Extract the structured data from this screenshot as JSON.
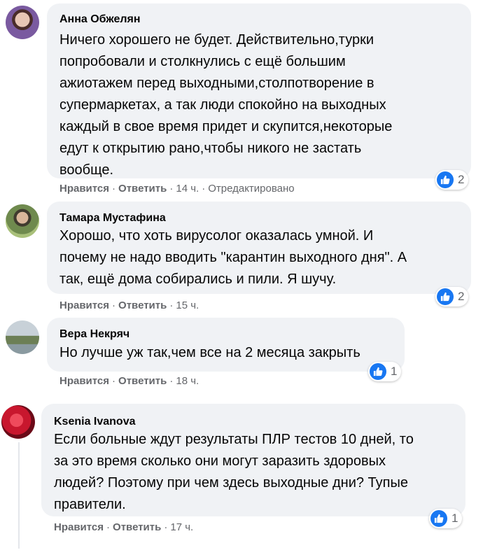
{
  "ui": {
    "like_label": "Нравится",
    "reply_label": "Ответить",
    "separator": "·"
  },
  "comments": [
    {
      "author": "Анна Обжелян",
      "lines": [
        "Ничего хорошего не будет. Действительно,турки",
        "попробовали и столкнулись с ещё большим",
        "ажиотажем перед выходными,столпотворение в",
        "супермаркетах, а так люди спокойно на выходных",
        "каждый в свое время придет и скупится,некоторые",
        "едут к открытию рано,чтобы никого не застать",
        "вообще."
      ],
      "time": "14 ч.",
      "edited": "Отредактировано",
      "reactions": "2",
      "reaction_icon": "like-icon",
      "avatar_colors": [
        "#6b4a8a",
        "#caa2a0"
      ]
    },
    {
      "author": "Тамара Мустафина",
      "lines": [
        "Хорошо, что хоть вирусолог оказалась умной. И",
        "почему не надо вводить \"карантин выходного дня\". А",
        "так, ещё дома собирались и пили. Я шучу."
      ],
      "time": "15 ч.",
      "reactions": "2",
      "reaction_icon": "like-icon",
      "avatar_colors": [
        "#5b7a3e",
        "#c9b7a6"
      ]
    },
    {
      "author": "Вера Некряч",
      "lines": [
        "Но лучше уж так,чем все на 2 месяца закрыть"
      ],
      "time": "18 ч.",
      "reactions": "1",
      "reaction_icon": "like-icon",
      "avatar_colors": [
        "#9aa7b0",
        "#5e7a52"
      ]
    },
    {
      "author": "Ksenia Ivanova",
      "lines": [
        "Если больные ждут результаты ПЛР тестов 10 дней, то",
        "за это время сколько они могут заразить здоровых",
        "людей? Поэтому при чем здесь выходные дни? Тупые",
        "правители."
      ],
      "time": "17 ч.",
      "reactions": "1",
      "reaction_icon": "like-icon",
      "avatar_colors": [
        "#b0132b",
        "#e0334a"
      ]
    }
  ]
}
